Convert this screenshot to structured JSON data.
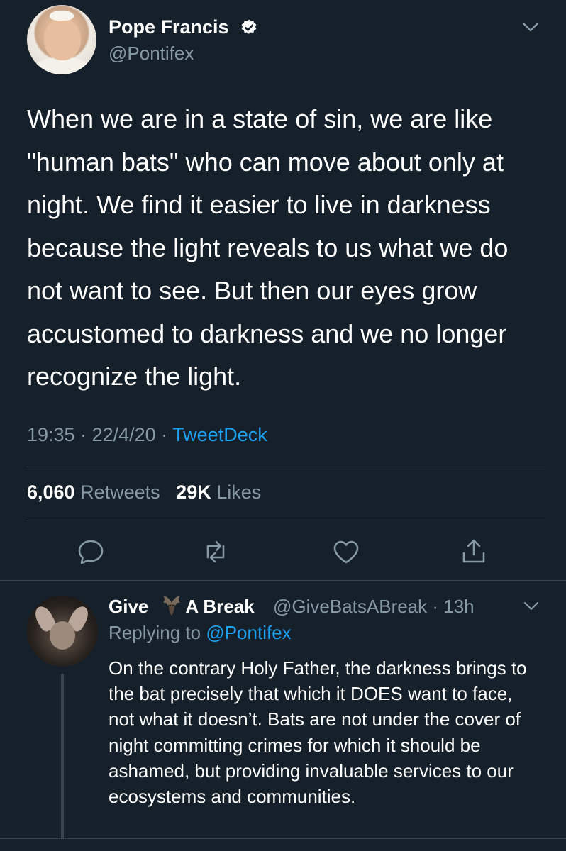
{
  "tweet": {
    "author_name": "Pope Francis",
    "author_handle": "@Pontifex",
    "text": "When we are in a state of sin, we are like \"human bats\" who can move about only at night. We find it easier to live in darkness because the light reveals to us what we do not want to see. But then our eyes grow accustomed to darkness and we no longer recognize the light.",
    "time": "19:35 · 22/4/20 · ",
    "source": "TweetDeck",
    "retweets_count": "6,060",
    "retweets_label": "Retweets",
    "likes_count": "29K",
    "likes_label": "Likes",
    "actions": [
      "reply-icon",
      "retweet-icon",
      "like-icon",
      "share-icon"
    ]
  },
  "reply": {
    "name_part1": "Give",
    "name_emoji": "bat-emoji",
    "name_part2": "A Break",
    "handle_time": "@GiveBatsABreak · 13h",
    "replying_prefix": "Replying to ",
    "replying_to": "@Pontifex",
    "text": "On the contrary Holy Father, the darkness brings to the bat precisely that which it DOES want to face, not what it doesn’t. Bats are not under the cover of night committing crimes for which it should be ashamed, but providing invaluable services to our ecosystems and communities."
  },
  "colors": {
    "background": "#15202b",
    "secondary_text": "#8899a6",
    "link": "#1da1f2",
    "divider": "#38444d"
  }
}
